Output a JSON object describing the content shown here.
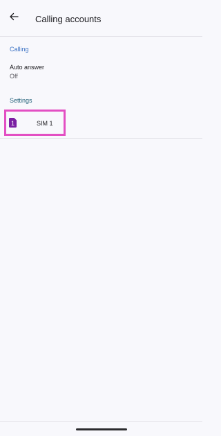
{
  "app_bar": {
    "title": "Calling accounts",
    "back_icon": "arrow-back-icon"
  },
  "sections": {
    "calling": {
      "header": "Calling",
      "auto_answer": {
        "title": "Auto answer",
        "summary": "Off"
      }
    },
    "settings": {
      "header": "Settings",
      "sim": {
        "badge": "1",
        "label": "SIM 1",
        "icon": "sim-card-icon",
        "icon_color": "#7a1fa2"
      }
    }
  },
  "colors": {
    "calling_header": "#3d73c4",
    "settings_header": "#24627a",
    "highlight_border": "#e34fc3"
  }
}
